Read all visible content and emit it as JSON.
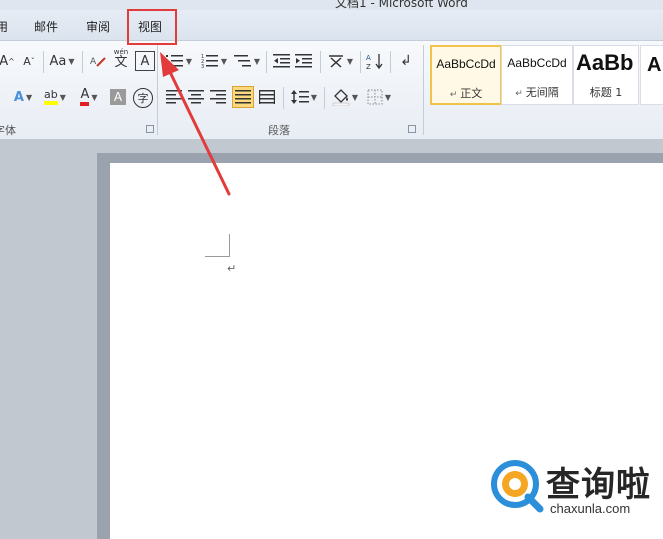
{
  "window": {
    "title": "文档1 - Microsoft Word"
  },
  "tabs": [
    {
      "label": "用"
    },
    {
      "label": "邮件"
    },
    {
      "label": "审阅"
    },
    {
      "label": "视图"
    }
  ],
  "ribbon": {
    "font_group": {
      "label": "字体",
      "row1": {
        "grow_font": "A",
        "shrink_font": "A",
        "change_case": "Aa",
        "phonetic_guide": "文",
        "char_border": "A"
      },
      "row2": {
        "text_effect": "A",
        "highlight": "ab",
        "font_color": "A",
        "char_shading": "A",
        "enclose_char": "字"
      }
    },
    "paragraph_group": {
      "label": "段落"
    },
    "styles_group": {
      "tiles": [
        {
          "sample": "AaBbCcDd",
          "name": "正文"
        },
        {
          "sample": "AaBbCcDd",
          "name": "无间隔"
        },
        {
          "sample": "AaBb",
          "name": "标题 1"
        },
        {
          "sample": "A",
          "name": ""
        }
      ]
    }
  },
  "document": {
    "paragraph_mark": "↵"
  },
  "annotation": {
    "highlight_color": "#e23b3b"
  },
  "watermark": {
    "name": "查询啦",
    "domain": "chaxunla.com"
  }
}
